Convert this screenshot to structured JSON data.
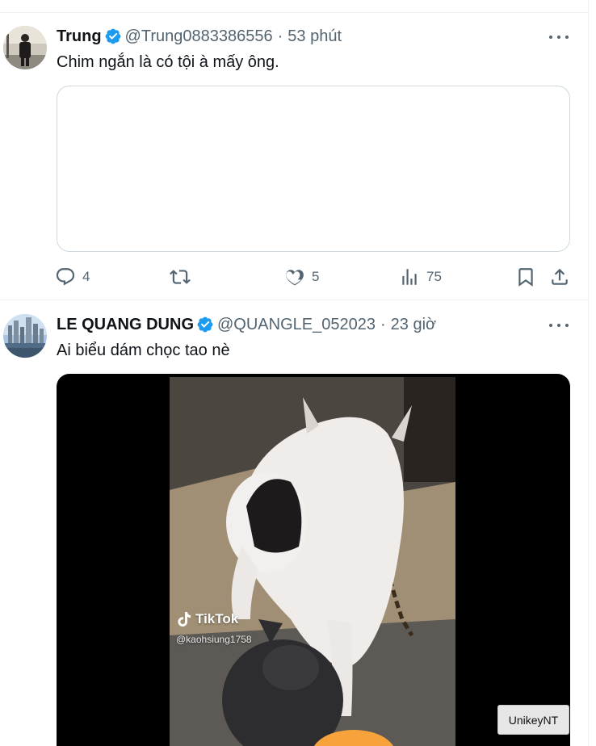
{
  "tweets": [
    {
      "name": "Trung",
      "handle": "@Trung0883386556",
      "separator": "·",
      "time": "53 phút",
      "text": "Chim ngắn là có tội à mấy ông.",
      "actions": {
        "reply_count": "4",
        "retweet_count": "",
        "like_count": "5",
        "view_count": "75"
      },
      "icons": [
        "verified-badge-icon",
        "more-icon",
        "reply-icon",
        "retweet-icon",
        "like-icon",
        "views-icon",
        "bookmark-icon",
        "share-icon"
      ]
    },
    {
      "name": "LE QUANG DUNG",
      "handle": "@QUANGLE_052023",
      "separator": "·",
      "time": "23 giờ",
      "text": "Ai biểu dám chọc tao nè",
      "video": {
        "watermark": "TikTok",
        "watermark_user": "@kaohsiung1758"
      }
    }
  ],
  "taskbar": {
    "unikey_label": "UnikeyNT"
  },
  "colors": {
    "verified": "#1d9bf0",
    "secondary_text": "#536471",
    "border": "#eff3f4",
    "media_border": "#cfd9de"
  }
}
